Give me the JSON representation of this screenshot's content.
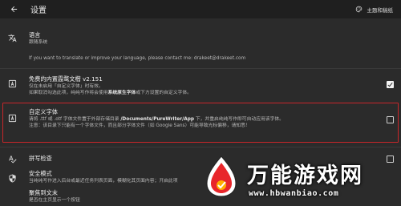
{
  "appbar": {
    "back_icon": "arrow-left-icon",
    "title": "设置",
    "theme_icon": "palette-icon",
    "theme_label": "主题和稿纸"
  },
  "settings": {
    "language": {
      "icon": "translate-icon",
      "title": "语言",
      "subtitle": "跟随系统",
      "note": "If you want to translate or improve your language, please contact me: drakeet@drakeet.com"
    },
    "builtin_font": {
      "icon": "font-icon",
      "title": "免费的内置霞鹜文楷 v2.151",
      "line1": "仅在未启用「自定义字体」时有效。",
      "line2_prefix": "如果取消勾选此项，纯纯写作将会使用",
      "line2_bold": "系统原生字体",
      "line2_suffix": "或下方设置的自定义字体。",
      "checked": true
    },
    "custom_font": {
      "icon": "font-icon",
      "title": "自定义字体",
      "line1_prefix": "请将 .ttf 或 .otf 字体文件置于外部存储目录 ",
      "line1_bold": "/Documents/PureWriter/App",
      "line1_suffix": " 下，并重启纯纯写作即可自动应用该字体。",
      "line2": "注意：该目录下只能有一个字体文件，而且部分字体文件（如 Google Sans）可能导致光标偏移，请知悉！",
      "checked": false
    },
    "spellcheck": {
      "icon": "spellcheck-icon",
      "title": "拼写检查",
      "checked": false
    },
    "safe_mode": {
      "icon": "shield-icon",
      "title": "安全模式",
      "subtitle": "当纯纯写作进入后台或最近任务列表页面，模糊化其页面内容；开启此项"
    },
    "focus": {
      "title": "聚焦到文末",
      "subtitle": "是否在主页显示一个按钮"
    }
  },
  "watermark": {
    "name": "万能游戏网",
    "url": "www.hbwanbiao.com"
  }
}
